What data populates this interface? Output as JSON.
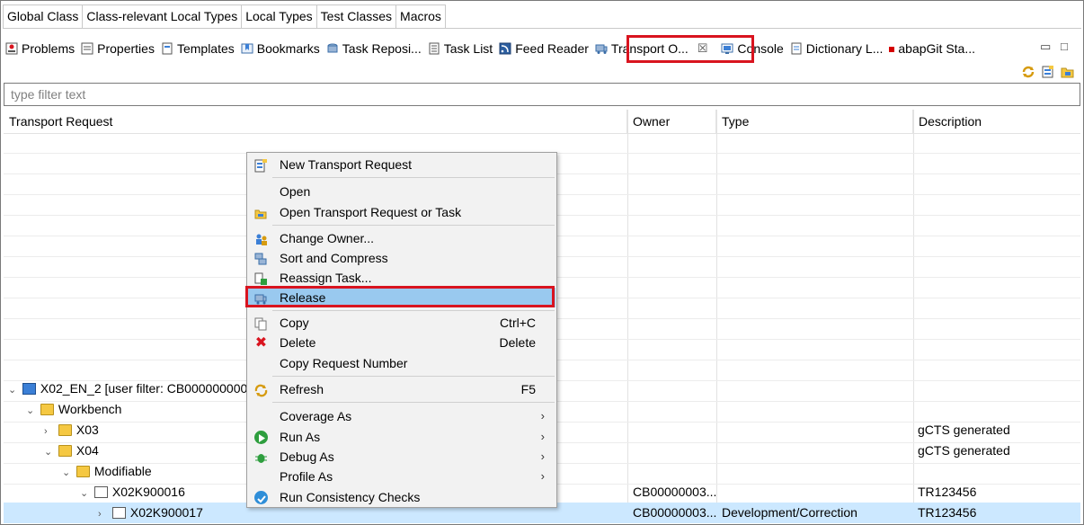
{
  "editor_tabs": [
    "Global Class",
    "Class-relevant Local Types",
    "Local Types",
    "Test Classes",
    "Macros"
  ],
  "view_tabs": [
    {
      "label": "Problems",
      "icon": "problems-icon"
    },
    {
      "label": "Properties",
      "icon": "properties-icon"
    },
    {
      "label": "Templates",
      "icon": "templates-icon"
    },
    {
      "label": "Bookmarks",
      "icon": "bookmarks-icon"
    },
    {
      "label": "Task Reposi...",
      "icon": "task-repository-icon"
    },
    {
      "label": "Task List",
      "icon": "task-list-icon"
    },
    {
      "label": "Feed Reader",
      "icon": "feed-reader-icon"
    },
    {
      "label": "Transport O...",
      "icon": "transport-organizer-icon",
      "active": true
    },
    {
      "label": "Console",
      "icon": "console-icon"
    },
    {
      "label": "Dictionary L...",
      "icon": "dictionary-log-icon"
    },
    {
      "label": "abapGit Sta...",
      "icon": "abapgit-icon"
    }
  ],
  "view_close": "☒",
  "filter": {
    "placeholder": "type filter text"
  },
  "columns": [
    "Transport Request",
    "Owner",
    "Type",
    "Description"
  ],
  "tree": [
    {
      "indent": 0,
      "twisty": "⌄",
      "icon": "system-icon",
      "label": "X02_EN_2 [user filter: CB00000000034",
      "owner": "",
      "type": "",
      "description": ""
    },
    {
      "indent": 1,
      "twisty": "⌄",
      "icon": "folder-icon",
      "label": "Workbench",
      "owner": "",
      "type": "",
      "description": ""
    },
    {
      "indent": 2,
      "twisty": "›",
      "icon": "folder-icon",
      "label": "X03",
      "owner": "",
      "type": "",
      "description": "gCTS generated"
    },
    {
      "indent": 2,
      "twisty": "⌄",
      "icon": "folder-icon",
      "label": "X04",
      "owner": "",
      "type": "",
      "description": "gCTS generated"
    },
    {
      "indent": 3,
      "twisty": "⌄",
      "icon": "folder-icon",
      "label": "Modifiable",
      "owner": "",
      "type": "",
      "description": ""
    },
    {
      "indent": 4,
      "twisty": "⌄",
      "icon": "request-icon",
      "label": "X02K900016",
      "owner": "CB00000003...",
      "type": "",
      "description": "TR123456"
    },
    {
      "indent": 5,
      "twisty": "›",
      "icon": "task-icon",
      "label": "X02K900017",
      "owner": "CB00000003...",
      "type": "Development/Correction",
      "description": "TR123456",
      "selected": true
    }
  ],
  "context_menu": [
    {
      "label": "New Transport Request",
      "icon": "new-request-icon",
      "shortcut": "",
      "submenu": false
    },
    {
      "separator": true
    },
    {
      "label": "Open",
      "icon": "",
      "shortcut": "",
      "submenu": false
    },
    {
      "label": "Open Transport Request or Task",
      "icon": "open-request-icon",
      "shortcut": "",
      "submenu": false
    },
    {
      "separator": true
    },
    {
      "label": "Change Owner...",
      "icon": "change-owner-icon",
      "shortcut": "",
      "submenu": false
    },
    {
      "label": "Sort and Compress",
      "icon": "sort-compress-icon",
      "shortcut": "",
      "submenu": false
    },
    {
      "label": "Reassign Task...",
      "icon": "reassign-task-icon",
      "shortcut": "",
      "submenu": false
    },
    {
      "label": "Release",
      "icon": "release-icon",
      "shortcut": "",
      "submenu": false,
      "hover": true
    },
    {
      "separator": true
    },
    {
      "label": "Copy",
      "icon": "copy-icon",
      "shortcut": "Ctrl+C",
      "submenu": false
    },
    {
      "label": "Delete",
      "icon": "delete-icon",
      "shortcut": "Delete",
      "submenu": false
    },
    {
      "label": "Copy Request Number",
      "icon": "",
      "shortcut": "",
      "submenu": false
    },
    {
      "separator": true
    },
    {
      "label": "Refresh",
      "icon": "refresh-icon",
      "shortcut": "F5",
      "submenu": false
    },
    {
      "separator": true
    },
    {
      "label": "Coverage As",
      "icon": "",
      "shortcut": "",
      "submenu": true
    },
    {
      "label": "Run As",
      "icon": "run-icon",
      "shortcut": "",
      "submenu": true
    },
    {
      "label": "Debug As",
      "icon": "debug-icon",
      "shortcut": "",
      "submenu": true
    },
    {
      "label": "Profile As",
      "icon": "",
      "shortcut": "",
      "submenu": true
    },
    {
      "label": "Run Consistency Checks",
      "icon": "consistency-check-icon",
      "shortcut": "",
      "submenu": false
    }
  ],
  "colors": {
    "highlight": "#d9141f",
    "selection": "#cce8ff",
    "menu_hover": "#99c9ef"
  }
}
